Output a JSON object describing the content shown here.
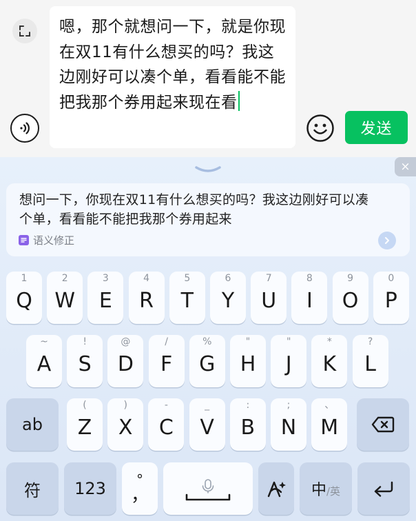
{
  "composer": {
    "message_text": "嗯，那个就想问一下，就是你现在双11有什么想买的吗？我这边刚好可以凑个单，看看能不能把我那个券用起来现在看",
    "send_label": "发送"
  },
  "suggestion": {
    "text": "想问一下，你现在双11有什么想买的吗？我这边刚好可以凑个单，看看能不能把我那个券用起来",
    "tag_label": "语义修正",
    "close_glyph": "×"
  },
  "keyboard": {
    "row1": [
      {
        "hint": "1",
        "key": "Q"
      },
      {
        "hint": "2",
        "key": "W"
      },
      {
        "hint": "3",
        "key": "E"
      },
      {
        "hint": "4",
        "key": "R"
      },
      {
        "hint": "5",
        "key": "T"
      },
      {
        "hint": "6",
        "key": "Y"
      },
      {
        "hint": "7",
        "key": "U"
      },
      {
        "hint": "8",
        "key": "I"
      },
      {
        "hint": "9",
        "key": "O"
      },
      {
        "hint": "0",
        "key": "P"
      }
    ],
    "row2": [
      {
        "hint": "~",
        "key": "A"
      },
      {
        "hint": "!",
        "key": "S"
      },
      {
        "hint": "@",
        "key": "D"
      },
      {
        "hint": "/",
        "key": "F"
      },
      {
        "hint": "%",
        "key": "G"
      },
      {
        "hint": "\"",
        "key": "H"
      },
      {
        "hint": "\"",
        "key": "J"
      },
      {
        "hint": "*",
        "key": "K"
      },
      {
        "hint": "?",
        "key": "L"
      }
    ],
    "row3": [
      {
        "hint": "(",
        "key": "Z"
      },
      {
        "hint": ")",
        "key": "X"
      },
      {
        "hint": "-",
        "key": "C"
      },
      {
        "hint": "_",
        "key": "V"
      },
      {
        "hint": ":",
        "key": "B"
      },
      {
        "hint": ";",
        "key": "N"
      },
      {
        "hint": "、",
        "key": "M"
      }
    ],
    "shift_label": "ab",
    "symbols_label": "符",
    "numbers_label": "123",
    "punct_top": "°",
    "punct_bottom": "，",
    "lang_main": "中",
    "lang_alt": "/英"
  },
  "colors": {
    "accent": "#07c160",
    "keyboard_bg": "#e4edf9",
    "func_key": "#c9d6ea"
  },
  "icons": {
    "collapse": "collapse-icon",
    "voice": "voice-icon",
    "emoji": "emoji-icon",
    "backspace": "backspace-icon",
    "microphone": "microphone-icon",
    "handwriting": "handwriting-icon",
    "enter": "enter-icon",
    "chevron_right": "chevron-right-icon",
    "fold": "chevron-down-icon"
  }
}
